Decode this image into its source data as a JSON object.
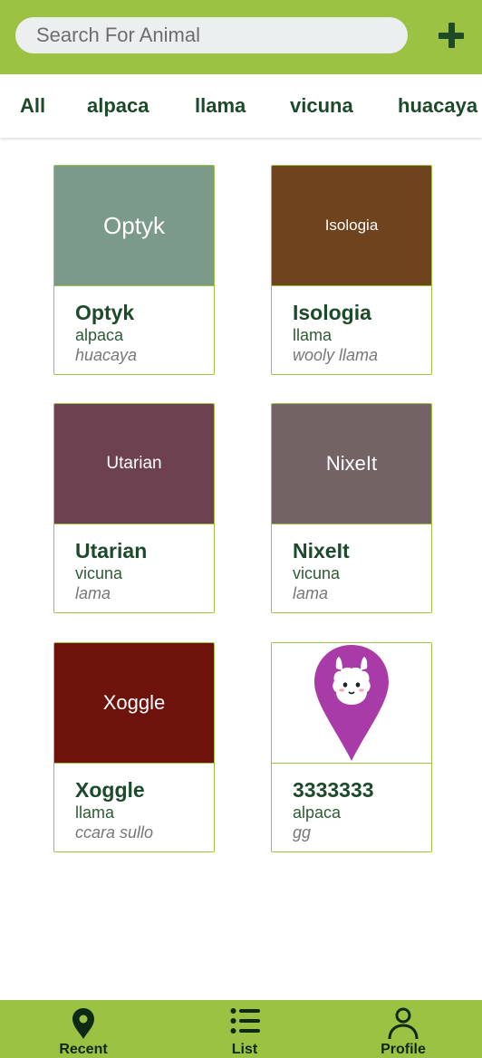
{
  "search": {
    "placeholder": "Search For Animal"
  },
  "tabs": [
    "All",
    "alpaca",
    "llama",
    "vicuna",
    "huacaya"
  ],
  "colors": {
    "brand_green": "#9bc243",
    "dark_green": "#1d4a2a",
    "pin_magenta": "#a93ba8"
  },
  "cards": [
    {
      "image_text": "Optyk",
      "image_color": "#7c9a89",
      "name": "Optyk",
      "type": "alpaca",
      "breed": "huacaya"
    },
    {
      "image_text": "Isologia",
      "image_color": "#6f431e",
      "name": "Isologia",
      "type": "llama",
      "breed": "wooly llama"
    },
    {
      "image_text": "Utarian",
      "image_color": "#6d4150",
      "name": "Utarian",
      "type": "vicuna",
      "breed": "lama"
    },
    {
      "image_text": "NixeIt",
      "image_color": "#736364",
      "name": "NixeIt",
      "type": "vicuna",
      "breed": "lama"
    },
    {
      "image_text": "Xoggle",
      "image_color": "#6e130c",
      "name": "Xoggle",
      "type": "llama",
      "breed": "ccara sullo"
    },
    {
      "image_icon": "llama-location-pin-icon",
      "name": "3333333",
      "type": "alpaca",
      "breed": "gg"
    }
  ],
  "nav": [
    {
      "label": "Recent",
      "icon": "location-pin-icon"
    },
    {
      "label": "List",
      "icon": "list-icon"
    },
    {
      "label": "Profile",
      "icon": "person-icon"
    }
  ]
}
